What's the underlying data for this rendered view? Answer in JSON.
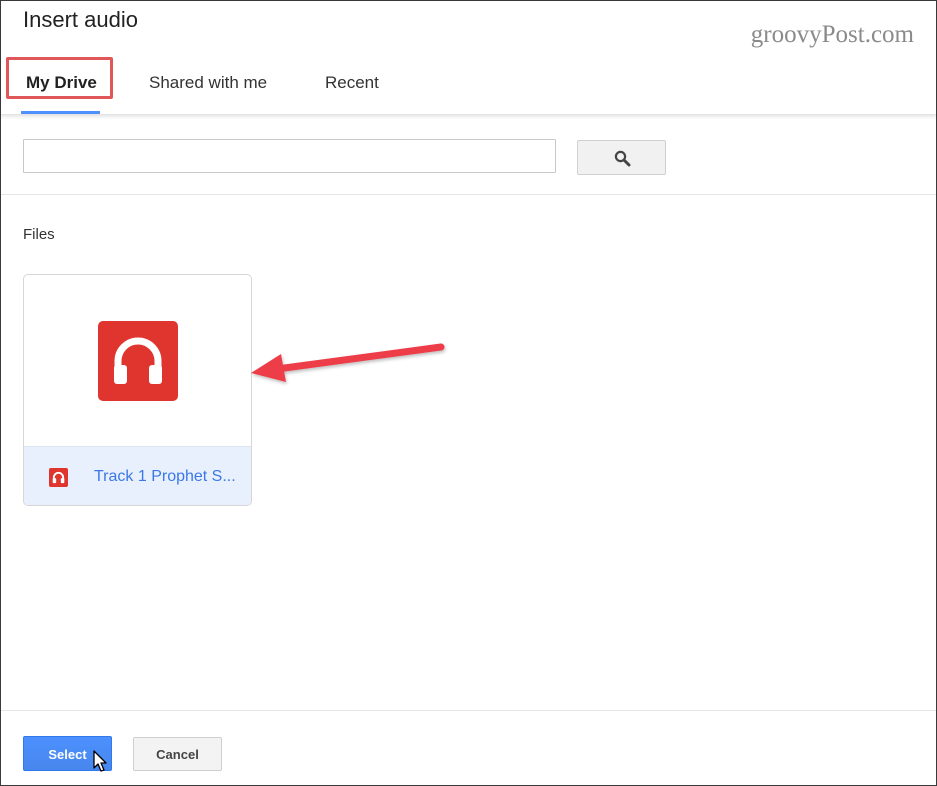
{
  "dialog": {
    "title": "Insert audio",
    "watermark": "groovyPost.com"
  },
  "tabs": [
    {
      "label": "My Drive",
      "active": true
    },
    {
      "label": "Shared with me",
      "active": false
    },
    {
      "label": "Recent",
      "active": false
    }
  ],
  "search": {
    "value": "",
    "placeholder": "",
    "button_icon": "search-icon"
  },
  "files": {
    "section_label": "Files",
    "items": [
      {
        "name": "Track 1 Prophet S...",
        "icon": "headphones-icon",
        "selected": true
      }
    ]
  },
  "footer": {
    "select_label": "Select",
    "cancel_label": "Cancel"
  },
  "colors": {
    "accent_blue": "#4d90fe",
    "audio_icon_red": "#e0342e",
    "highlight_red": "#e0575a",
    "selected_bg": "#e8f0fd",
    "file_link": "#3b78e7"
  }
}
